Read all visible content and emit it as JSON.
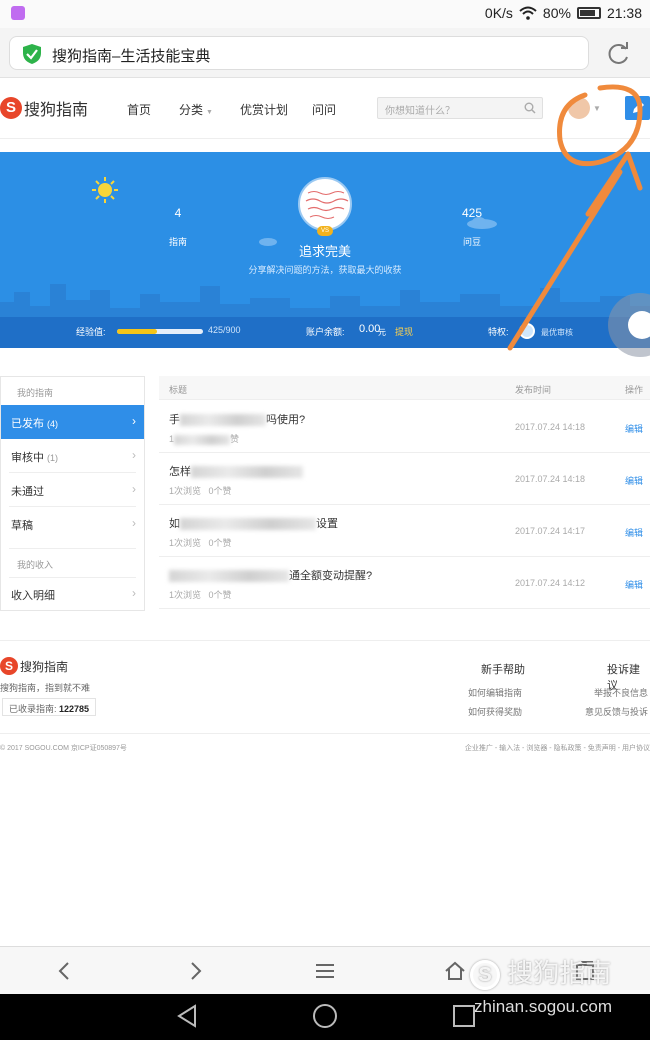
{
  "status": {
    "network": "0K/s",
    "battery": "80%",
    "time": "21:38"
  },
  "browser": {
    "page_title": "搜狗指南–生活技能宝典"
  },
  "site": {
    "logo": "搜狗指南",
    "nav": [
      "首页",
      "分类",
      "优赏计划",
      "问问"
    ],
    "search_placeholder": "你想知道什么？"
  },
  "profile": {
    "guides_count": "4",
    "guides_label": "指南",
    "beans_count": "425",
    "beans_label": "问豆",
    "avatar_badge": "VS",
    "nickname": "追求完美",
    "motto": "分享解决问题的方法，获取最大的收获",
    "exp_label": "经验值:",
    "exp_value": "425/900",
    "exp_progress": 0.47,
    "balance_label": "账户余额:",
    "balance_value": "0.00",
    "balance_unit": "元",
    "withdraw": "提现",
    "privilege_label": "特权:",
    "privilege_value": "最优审核"
  },
  "sidebar": {
    "section1": "我的指南",
    "items": [
      {
        "label": "已发布",
        "count": "(4)"
      },
      {
        "label": "审核中",
        "count": "(1)"
      },
      {
        "label": "未通过",
        "count": ""
      },
      {
        "label": "草稿",
        "count": ""
      }
    ],
    "section2": "我的收入",
    "income_item": "收入明细"
  },
  "table": {
    "headers": {
      "title": "标题",
      "date": "发布时间",
      "op": "操作"
    },
    "rows": [
      {
        "title_start": "手",
        "title_end": "吗使用?",
        "meta": "1",
        "meta_end": "赞",
        "date": "2017.07.24 14:18",
        "op": "编辑"
      },
      {
        "title_start": "怎样",
        "title_end": "",
        "meta": "1次浏览",
        "meta_end": "0个赞",
        "date": "2017.07.24 14:18",
        "op": "编辑"
      },
      {
        "title_start": "如",
        "title_end": "设置",
        "meta": "1次浏览",
        "meta_end": "0个赞",
        "date": "2017.07.24 14:17",
        "op": "编辑"
      },
      {
        "title_start": "",
        "title_end": "通全额变动提醒?",
        "meta": "1次浏览",
        "meta_end": "0个赞",
        "date": "2017.07.24 14:12",
        "op": "编辑"
      }
    ]
  },
  "footer": {
    "logo": "搜狗指南",
    "slogan": "搜狗指南，指到就不难",
    "count_label": "已收录指南:",
    "count_value": "122785",
    "help_title": "新手帮助",
    "help_links": [
      "如何编辑指南",
      "如何获得奖励"
    ],
    "complaint_title": "投诉建议",
    "complaint_links": [
      "举报不良信息",
      "意见反馈与投诉"
    ],
    "copyright": "© 2017 SOGOU.COM 京ICP证050897号",
    "links": "企业推广 - 输入法 - 浏览器 - 隐私政策 - 免责声明 - 用户协议"
  },
  "watermark": {
    "text": "搜狗指南",
    "url": "zhinan.sogou.com"
  },
  "colors": {
    "accent": "#2f8ee8",
    "banner": "#2c8fe5",
    "logo": "#e8462a",
    "annotation": "#f08a3c"
  }
}
